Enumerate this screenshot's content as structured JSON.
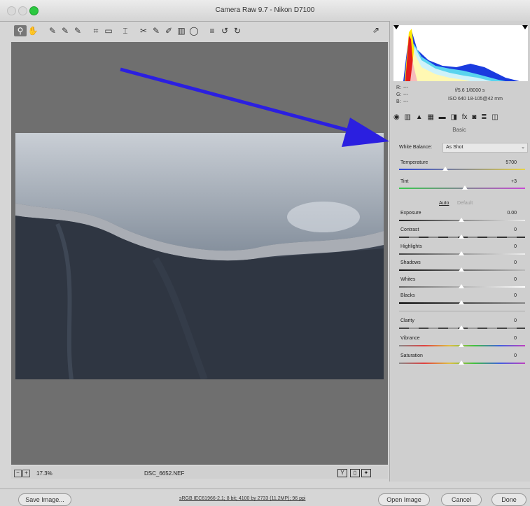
{
  "window": {
    "title": "Camera Raw 9.7  -  Nikon D7100"
  },
  "toolbar": {
    "tools": [
      "⚲",
      "✋",
      "✎",
      "✎",
      "✎",
      "⌗",
      "▭",
      "⌶",
      "✂",
      "✎",
      "✐",
      "▥",
      "◯",
      "≡",
      "↺",
      "↻"
    ],
    "export": "⇗"
  },
  "status": {
    "zoom": "17.3%",
    "filename": "DSC_6652.NEF",
    "views": [
      "Y",
      "▯",
      "✦"
    ]
  },
  "histogram": {
    "r_label": "R:",
    "g_label": "G:",
    "b_label": "B:",
    "r": "---",
    "g": "---",
    "b": "---",
    "aperture_shutter": "f/5.6   1/8000 s",
    "iso_lens": "ISO 640   18-105@42 mm"
  },
  "panel": {
    "title": "Basic",
    "tab_icons": [
      "◉",
      "▥",
      "▲",
      "▦",
      "▬",
      "◨",
      "fx",
      "◙",
      "≣",
      "◫"
    ],
    "white_balance_label": "White Balance:",
    "white_balance_value": "As Shot",
    "temperature": {
      "label": "Temperature",
      "value": "5700"
    },
    "tint": {
      "label": "Tint",
      "value": "+3"
    },
    "auto": "Auto",
    "default": "Default",
    "exposure": {
      "label": "Exposure",
      "value": "0.00"
    },
    "contrast": {
      "label": "Contrast",
      "value": "0"
    },
    "highlights": {
      "label": "Highlights",
      "value": "0"
    },
    "shadows": {
      "label": "Shadows",
      "value": "0"
    },
    "whites": {
      "label": "Whites",
      "value": "0"
    },
    "blacks": {
      "label": "Blacks",
      "value": "0"
    },
    "clarity": {
      "label": "Clarity",
      "value": "0"
    },
    "vibrance": {
      "label": "Vibrance",
      "value": "0"
    },
    "saturation": {
      "label": "Saturation",
      "value": "0"
    }
  },
  "footer": {
    "save": "Save Image...",
    "workflow": "sRGB IEC61966-2.1; 8 bit; 4100 by 2733 (11.2MP); 96 ppi",
    "open": "Open Image",
    "cancel": "Cancel",
    "done": "Done"
  },
  "colors": {
    "arrow": "#2b1fe0",
    "canvas": "#6f6f6f"
  }
}
